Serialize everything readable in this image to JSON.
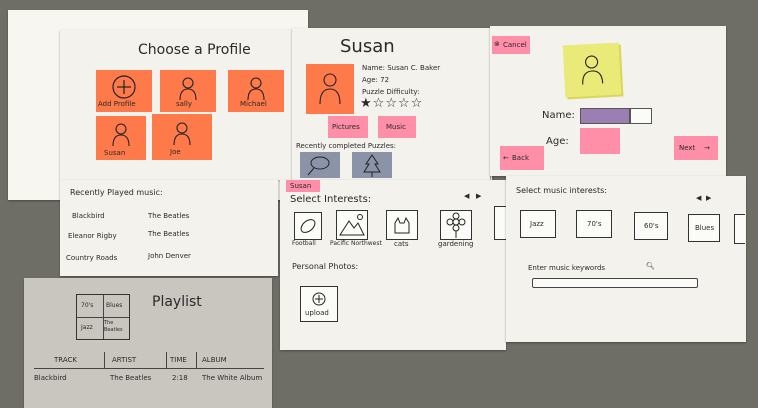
{
  "choose_profile": {
    "title": "Choose a Profile",
    "profiles": [
      {
        "label": "Add Profile"
      },
      {
        "label": "sally"
      },
      {
        "label": "Michael"
      },
      {
        "label": "Susan"
      },
      {
        "label": "Joe"
      }
    ]
  },
  "profile_detail": {
    "title": "Susan",
    "name_label": "Name: Susan C. Baker",
    "age_label": "Age: 72",
    "difficulty_label": "Puzzle Difficulty:",
    "difficulty_rating": 1,
    "difficulty_max": 5,
    "pictures_button": "Pictures",
    "music_button": "Music",
    "recent_puzzles_label": "Recently completed Puzzles:"
  },
  "new_profile": {
    "cancel_button": "Cancel",
    "name_label": "Name:",
    "age_label": "Age:",
    "back_button": "Back",
    "next_button": "Next"
  },
  "recent_music": {
    "title": "Recently Played music:",
    "rows": [
      {
        "song": "Blackbird",
        "artist": "The Beatles"
      },
      {
        "song": "Eleanor Rigby",
        "artist": "The Beatles"
      },
      {
        "song": "Country Roads",
        "artist": "John Denver"
      }
    ]
  },
  "interests": {
    "tag": "Susan",
    "title": "Select Interests:",
    "items": [
      {
        "label": "Football"
      },
      {
        "label": "Pacific Northwest"
      },
      {
        "label": "cats"
      },
      {
        "label": "gardening"
      }
    ],
    "photos_title": "Personal Photos:",
    "upload_label": "upload"
  },
  "music_interests": {
    "title": "Select music interests:",
    "genres": [
      "Jazz",
      "70's",
      "60's",
      "Blues"
    ],
    "keywords_label": "Enter music keywords"
  },
  "playlist": {
    "title": "Playlist",
    "cover_cells": [
      "70's",
      "Blues",
      "Jazz",
      "The Beatles"
    ],
    "columns": [
      "TRACK",
      "ARTIST",
      "TIME",
      "ALBUM"
    ],
    "rows": [
      {
        "track": "Blackbird",
        "artist": "The Beatles",
        "time": "2:18",
        "album": "The White Album"
      }
    ]
  }
}
